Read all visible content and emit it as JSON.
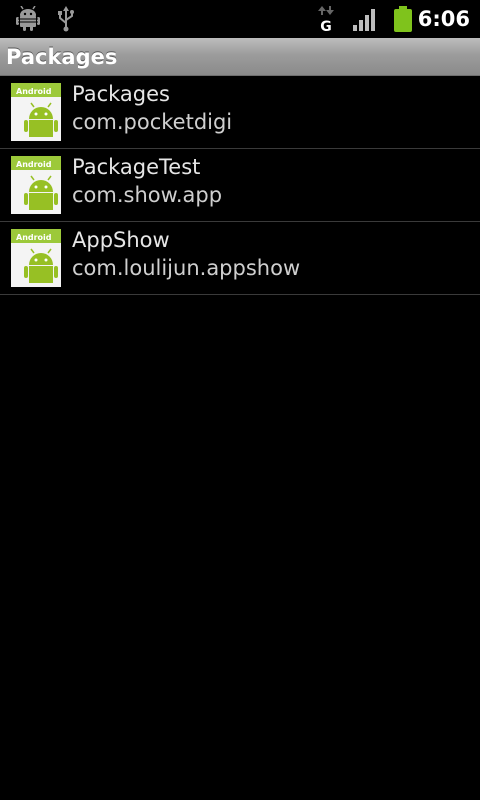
{
  "status_bar": {
    "time": "6:06",
    "icons": [
      "android-debug-icon",
      "usb-icon",
      "gprs-data-icon",
      "signal-strength-icon",
      "battery-icon"
    ],
    "network_label": "G"
  },
  "title_bar": {
    "title": "Packages"
  },
  "packages": [
    {
      "name": "Packages",
      "package": "com.pocketdigi",
      "icon": "android-app-icon",
      "icon_label": "Android"
    },
    {
      "name": "PackageTest",
      "package": "com.show.app",
      "icon": "android-app-icon",
      "icon_label": "Android"
    },
    {
      "name": "AppShow",
      "package": "com.loulijun.appshow",
      "icon": "android-app-icon",
      "icon_label": "Android"
    }
  ],
  "colors": {
    "background": "#000000",
    "title_bar": "#9c9c9c",
    "battery": "#7fc31c",
    "android_green": "#97c024",
    "divider": "#3a3a3a"
  }
}
